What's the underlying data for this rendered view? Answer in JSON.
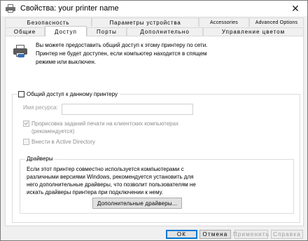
{
  "window": {
    "title": "Свойства: your printer name",
    "close_glyph": "✕"
  },
  "tabs": {
    "row1": [
      "Безопасность",
      "Параметры устройства",
      "Accessories",
      "Advanced Options"
    ],
    "row2": [
      "Общие",
      "Доступ",
      "Порты",
      "Дополнительно",
      "Управление цветом"
    ],
    "active": "Доступ"
  },
  "sharing": {
    "intro": "Вы можете предоставить общий доступ к этому принтеру по сети. Принтер не будет доступен, если компьютер находится в спящем режиме или выключен.",
    "share_checkbox_label": "Общий доступ к данному принтеру",
    "share_checked": false,
    "resource_label": "Имя ресурса:",
    "resource_value": "",
    "render_label": "Прорисовка заданий печати на клиентских компьютерах (рекомендуется)",
    "render_checked": true,
    "ad_label": "Внести в Active Directory",
    "ad_checked": false
  },
  "drivers": {
    "title": "Драйверы",
    "text": "Если этот принтер совместно используется компьютерами с различными версиями Windows, рекомендуется установить для него дополнительные драйверы, что позволит пользователям не искать драйверы принтера при подключении к нему.",
    "button_label": "Дополнительные драйверы..."
  },
  "buttons": {
    "ok": "ОК",
    "cancel": "Отмена",
    "apply": "Применить",
    "help": "Справка"
  },
  "icons": {
    "title": "printer-icon",
    "sharing": "shared-printer-icon",
    "close": "close-icon"
  }
}
